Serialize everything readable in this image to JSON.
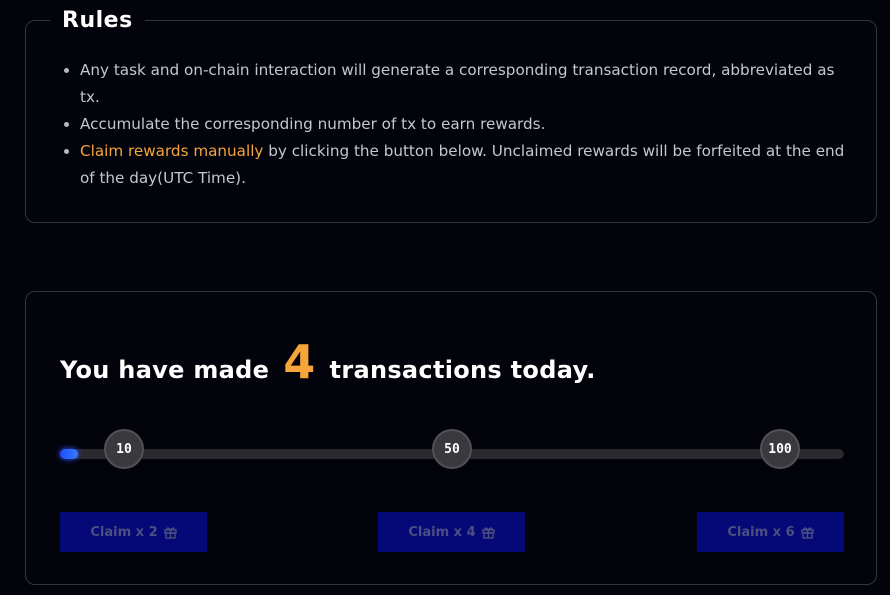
{
  "rules": {
    "title": "Rules",
    "items": [
      {
        "text": "Any task and on-chain interaction will generate a corresponding transaction record, abbreviated as tx."
      },
      {
        "text": "Accumulate the corresponding number of tx to earn rewards."
      },
      {
        "highlight": "Claim rewards manually",
        "text": " by clicking the button below. Unclaimed rewards will be forfeited at the end of the day(UTC Time)."
      }
    ]
  },
  "transactions": {
    "prefix": "You have made",
    "count": "4",
    "suffix": "transactions today."
  },
  "progress": {
    "value": 4,
    "max": 100,
    "milestones": [
      {
        "label": "10"
      },
      {
        "label": "50"
      },
      {
        "label": "100"
      }
    ]
  },
  "claims": [
    {
      "label": "Claim x 2",
      "icon": "gift-icon"
    },
    {
      "label": "Claim x 4",
      "icon": "gift-icon"
    },
    {
      "label": "Claim x 6",
      "icon": "gift-icon"
    }
  ],
  "colors": {
    "accent": "#f5a53a",
    "progress": "#1e4cff",
    "button_bg": "#050877",
    "button_text": "#4b4f82"
  }
}
